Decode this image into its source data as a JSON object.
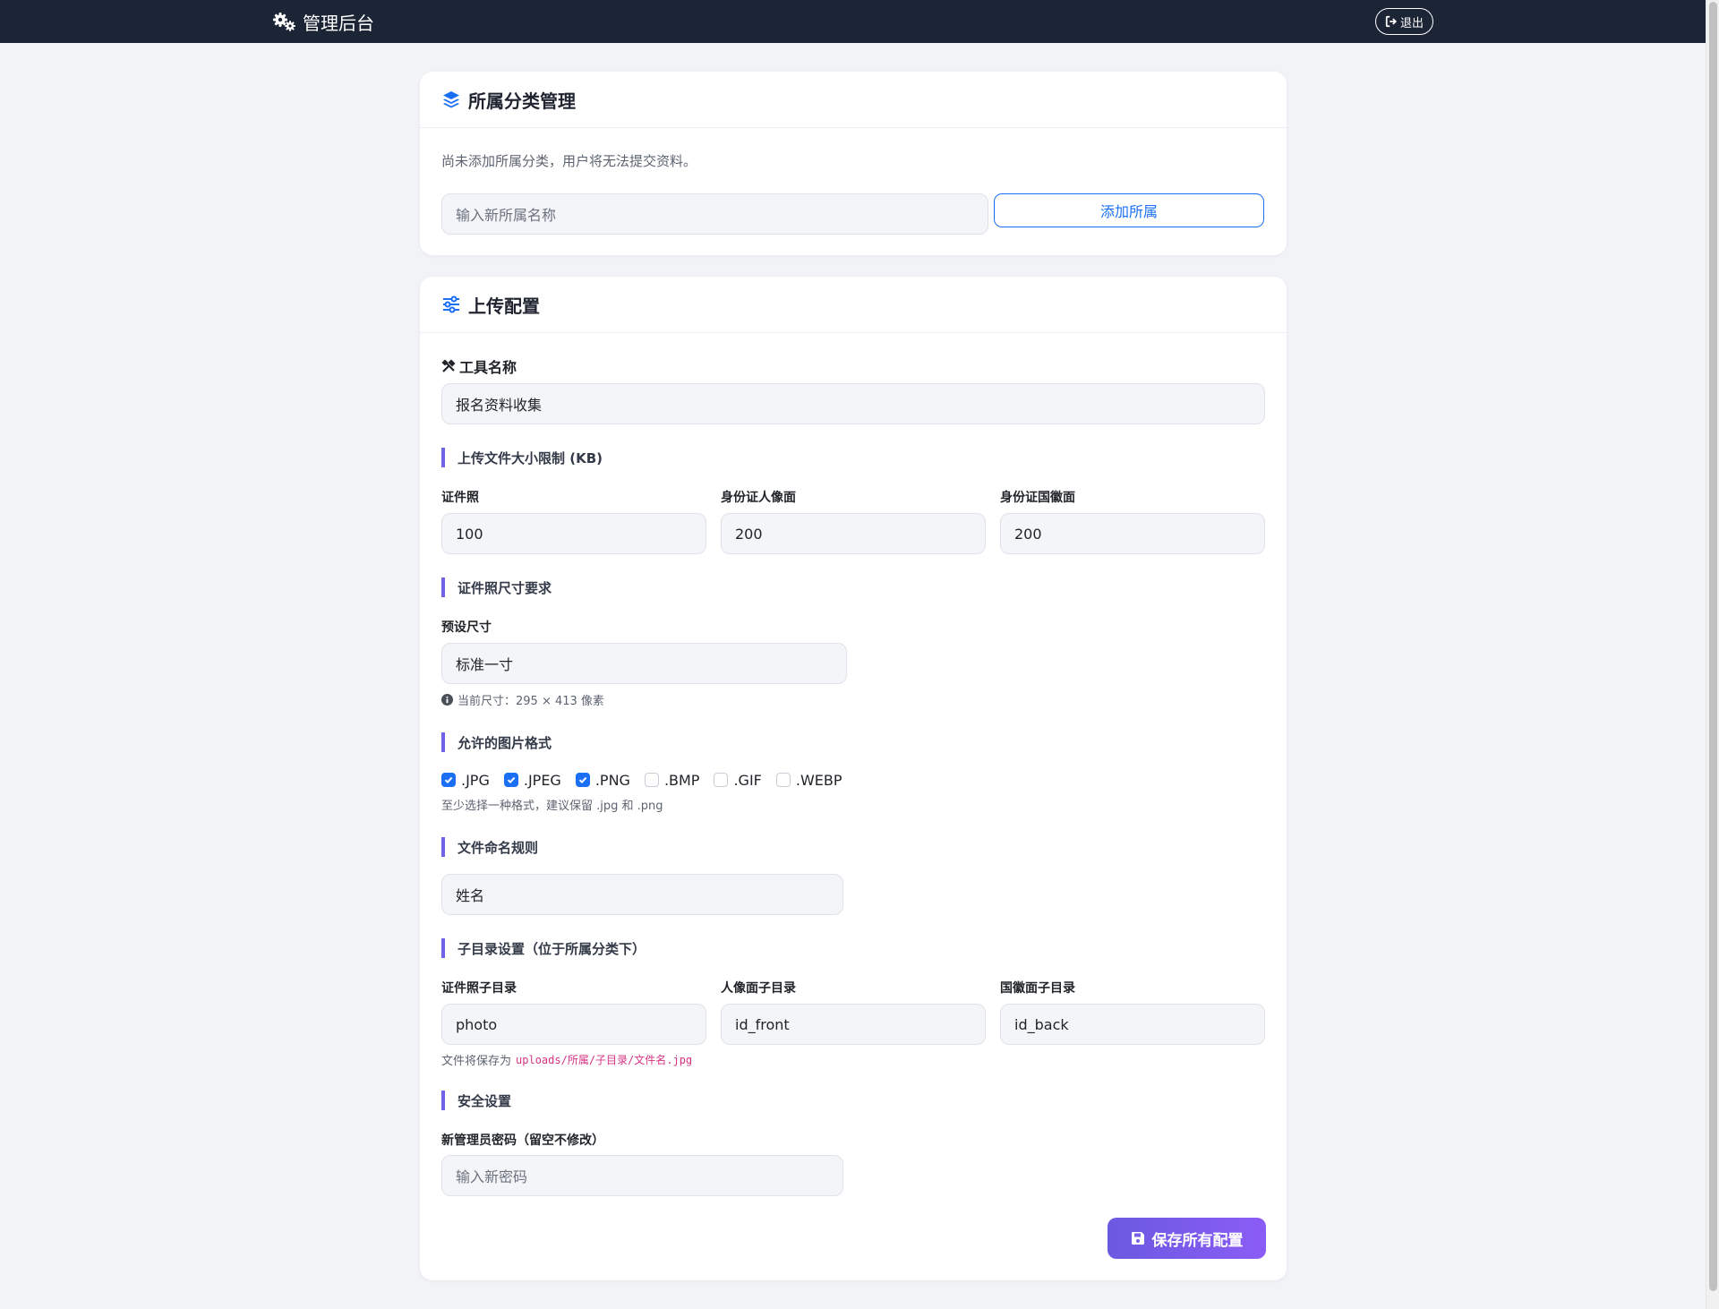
{
  "navbar": {
    "brand": "管理后台",
    "logout_label": "退出"
  },
  "category_card": {
    "title": "所属分类管理",
    "empty_notice": "尚未添加所属分类，用户将无法提交资料。",
    "new_category_placeholder": "输入新所属名称",
    "add_button": "添加所属"
  },
  "upload_card": {
    "title": "上传配置",
    "tool_name_label": "工具名称",
    "tool_name_value": "报名资料收集",
    "size_limit_section": "上传文件大小限制 (KB)",
    "size_limits": [
      {
        "label": "证件照",
        "value": "100"
      },
      {
        "label": "身份证人像面",
        "value": "200"
      },
      {
        "label": "身份证国徽面",
        "value": "200"
      }
    ],
    "photo_size_section": "证件照尺寸要求",
    "preset_size_label": "预设尺寸",
    "preset_size_value": "标准一寸",
    "current_size_hint": "当前尺寸：295 × 413 像素",
    "formats_section": "允许的图片格式",
    "formats": [
      {
        "label": ".JPG",
        "checked": true
      },
      {
        "label": ".JPEG",
        "checked": true
      },
      {
        "label": ".PNG",
        "checked": true
      },
      {
        "label": ".BMP",
        "checked": false
      },
      {
        "label": ".GIF",
        "checked": false
      },
      {
        "label": ".WEBP",
        "checked": false
      }
    ],
    "formats_hint": "至少选择一种格式，建议保留 .jpg 和 .png",
    "naming_section": "文件命名规则",
    "naming_value": "姓名",
    "subdir_section": "子目录设置（位于所属分类下）",
    "subdirs": [
      {
        "label": "证件照子目录",
        "value": "photo"
      },
      {
        "label": "人像面子目录",
        "value": "id_front"
      },
      {
        "label": "国徽面子目录",
        "value": "id_back"
      }
    ],
    "save_path_prefix": "文件将保存为",
    "save_path_code": "uploads/所属/子目录/文件名.jpg",
    "security_section": "安全设置",
    "password_label": "新管理员密码（留空不修改）",
    "password_placeholder": "输入新密码",
    "save_button": "保存所有配置"
  },
  "colors": {
    "navbar_bg": "#1c2536",
    "accent_blue": "#1a6ff5",
    "accent_purple": "#6f63e8"
  }
}
